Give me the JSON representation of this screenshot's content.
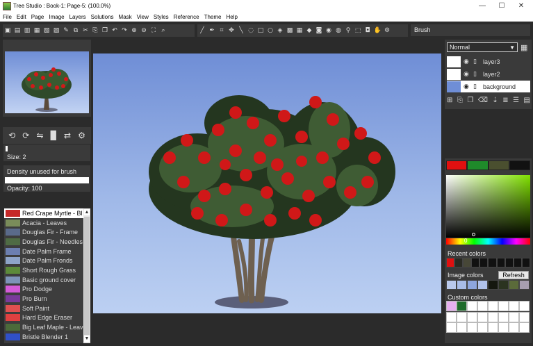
{
  "window": {
    "title": "Tree Studio : Book-1: Page-5: (100.0%)"
  },
  "menu": [
    "File",
    "Edit",
    "Page",
    "Image",
    "Layers",
    "Solutions",
    "Mask",
    "View",
    "Styles",
    "Reference",
    "Theme",
    "Help"
  ],
  "toolbar": {
    "file_icons": [
      "save-icon",
      "new-icon",
      "open-icon",
      "export-icon",
      "image-icon",
      "page-icon",
      "brush-tool-icon",
      "copy-icon",
      "cut-icon",
      "paste-icon",
      "duplicate-icon",
      "undo-icon",
      "redo-icon",
      "zoom-in-icon",
      "zoom-out-icon",
      "fit-icon",
      "zoom-icon"
    ],
    "tool_icons": [
      "brush-icon",
      "eyedropper-icon",
      "crop-icon",
      "move-icon",
      "line-icon",
      "lasso-icon",
      "rectangle-icon",
      "ellipse-icon",
      "fill-icon",
      "gradient-icon",
      "pattern-icon",
      "stamp-icon",
      "smudge-icon",
      "burn-icon",
      "dodge-icon",
      "wand-icon",
      "transform-icon",
      "camera-icon",
      "hand-icon",
      "settings-icon"
    ],
    "current_tool": "Brush"
  },
  "brush_settings": {
    "size_label": "Size: 2",
    "size_value": 2,
    "density_label": "Density unused for brush",
    "opacity_label": "Opacity: 100",
    "opacity_value": 100
  },
  "navigator_icons": [
    "rotate-left-icon",
    "rotate-right-icon",
    "flip-icon",
    "page-icon",
    "flip-horizontal-icon",
    "settings-icon"
  ],
  "brushes": [
    {
      "label": "Red Crape Myrtle - Bl",
      "swatch": "#c62828",
      "selected": true
    },
    {
      "label": "Acacia - Leaves",
      "swatch": "#7a8c5a"
    },
    {
      "label": "Douglas Fir - Frame",
      "swatch": "#5a6a8a"
    },
    {
      "label": "Douglas Fir - Needles",
      "swatch": "#4f6b44"
    },
    {
      "label": "Date Palm Frame",
      "swatch": "#6c7fb0"
    },
    {
      "label": "Date Palm Fronds",
      "swatch": "#8ea4c8"
    },
    {
      "label": "Short Rough Grass",
      "swatch": "#5c8a3a"
    },
    {
      "label": "Basic ground cover",
      "swatch": "#7d93b8"
    },
    {
      "label": "Pro Dodge",
      "swatch": "#d45bd8"
    },
    {
      "label": "Pro Burn",
      "swatch": "#7a3a9a"
    },
    {
      "label": "Soft Paint",
      "swatch": "#e05050"
    },
    {
      "label": "Hard Edge Eraser",
      "swatch": "#e04040"
    },
    {
      "label": "Big Leaf Maple - Leave",
      "swatch": "#4b6a3a"
    },
    {
      "label": "Bristle Blender 1",
      "swatch": "#3050c8"
    }
  ],
  "layers": {
    "blend_mode": "Normal",
    "items": [
      {
        "name": "layer3",
        "active": false
      },
      {
        "name": "layer2",
        "active": false
      },
      {
        "name": "background",
        "active": true
      }
    ],
    "action_icons": [
      "add-layer-icon",
      "copy-layer-icon",
      "duplicate-layer-icon",
      "delete-layer-icon",
      "merge-icon",
      "layer-up-icon",
      "layer-down-icon",
      "layer-properties-icon"
    ]
  },
  "colors": {
    "primary_swatches": [
      "#e01010",
      "#1f8a2a",
      "#4a4f2f",
      "#111111"
    ],
    "picker_value_label": "0",
    "recent_label": "Recent colors",
    "recent": [
      "#e01010",
      "#2a2a22",
      "#474737",
      "#111111",
      "#111111",
      "#111111",
      "#111111",
      "#111111",
      "#111111",
      "#111111"
    ],
    "image_label": "Image colors",
    "refresh_label": "Refresh",
    "image": [
      "#b9c9ec",
      "#a9bde8",
      "#8ea6de",
      "#b0c1ea",
      "#15170f",
      "#2b3320",
      "#5b6b3a",
      "#a89fb0"
    ],
    "custom_label": "Custom colors",
    "custom": [
      "#e6b0f0",
      "#1e6b2a"
    ]
  }
}
